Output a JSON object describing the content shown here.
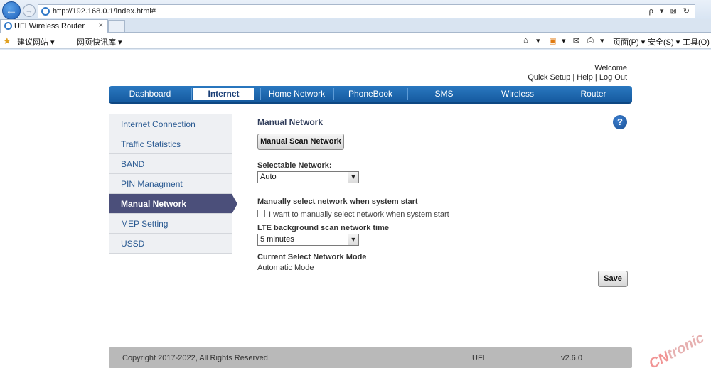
{
  "browser": {
    "url": "http://192.168.0.1/index.html#",
    "tab_title": "UFI Wireless Router",
    "tab_close": "×",
    "addr_tools": "ρ ▾ ⊠ ↻",
    "favorites": [
      {
        "label": "建议网站 ▾"
      },
      {
        "label": "网页快讯库 ▾"
      }
    ],
    "commands": [
      {
        "label": "▾"
      },
      {
        "label": "▾"
      },
      {
        "label": "▾"
      },
      {
        "label": "页面(P) ▾"
      },
      {
        "label": "安全(S) ▾"
      },
      {
        "label": "工具(O) ▾"
      }
    ]
  },
  "header": {
    "welcome": "Welcome",
    "links": [
      "Quick Setup",
      "Help",
      "Log Out"
    ],
    "link_separator": " | "
  },
  "nav": {
    "items": [
      "Dashboard",
      "Internet",
      "Home Network",
      "PhoneBook",
      "SMS",
      "Wireless",
      "Router"
    ],
    "active_index": 1
  },
  "sidebar": {
    "items": [
      "Internet Connection",
      "Traffic Statistics",
      "BAND",
      "PIN Managment",
      "Manual Network",
      "MEP Setting",
      "USSD"
    ],
    "active_index": 4
  },
  "content": {
    "title": "Manual Network",
    "help": "?",
    "scan_button": "Manual Scan Network",
    "selectable_label": "Selectable Network:",
    "selectable_value": "Auto",
    "manual_label": "Manually select network when system start",
    "manual_checkbox_label": "I want to manually select network when system start",
    "manual_checked": false,
    "lte_label": "LTE background scan network time",
    "lte_value": "5 minutes",
    "mode_label": "Current Select Network Mode",
    "mode_value": "Automatic Mode",
    "save_button": "Save"
  },
  "footer": {
    "copyright": "Copyright 2017-2022, All Rights Reserved.",
    "device": "UFI",
    "version": "v2.6.0"
  },
  "watermark": {
    "prefix": "CN",
    "suffix": "tronic"
  },
  "colors": {
    "nav": "#1f6bb3",
    "sidebar_active": "#4b4f7a",
    "link": "#2a5a92"
  }
}
